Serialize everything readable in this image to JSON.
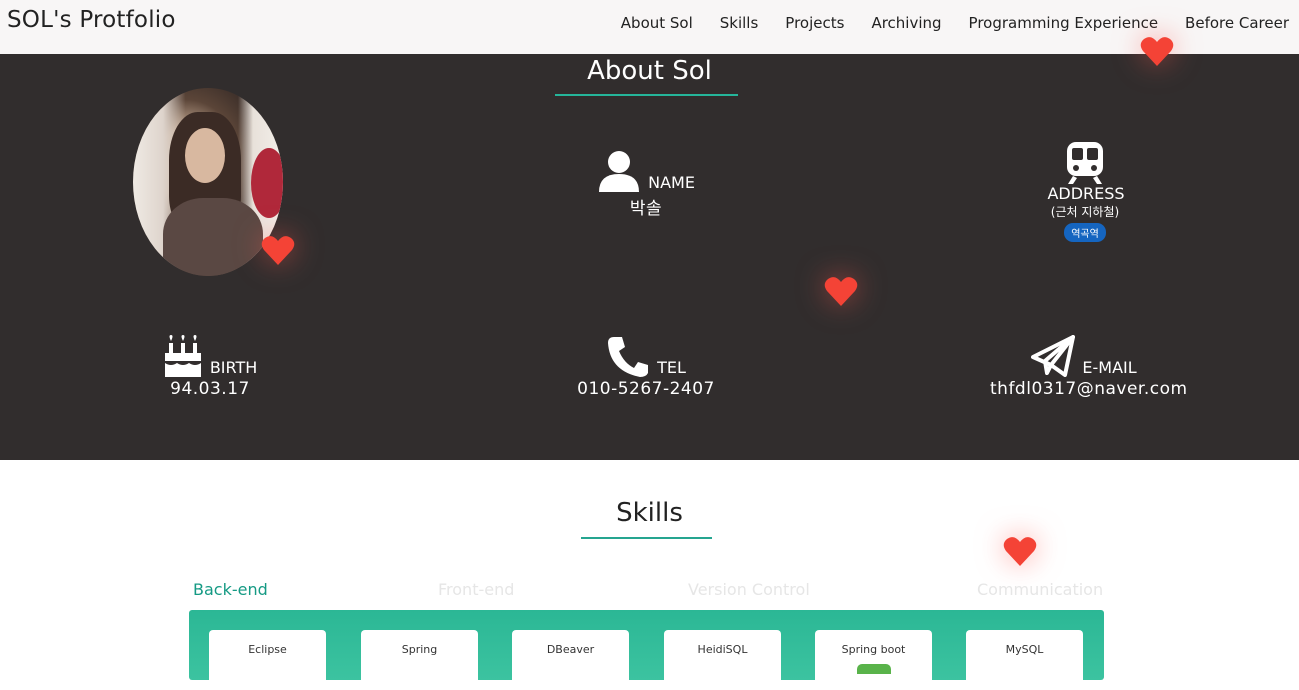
{
  "header": {
    "brand": "SOL's Protfolio",
    "nav": [
      "About Sol",
      "Skills",
      "Projects",
      "Archiving",
      "Programming Experience",
      "Before Career"
    ]
  },
  "about": {
    "title": "About Sol",
    "name": {
      "icon": "user-icon",
      "label": "NAME",
      "value": "박솔"
    },
    "address": {
      "icon": "train-icon",
      "label": "ADDRESS",
      "sub": "(근처 지하철)",
      "badge": "역곡역"
    },
    "birth": {
      "icon": "cake-icon",
      "label": "BIRTH",
      "value": "94.03.17"
    },
    "tel": {
      "icon": "phone-icon",
      "label": "TEL",
      "value": "010-5267-2407"
    },
    "email": {
      "icon": "paper-plane-icon",
      "label": "E-MAIL",
      "value": "thfdl0317@naver.com"
    }
  },
  "skills": {
    "title": "Skills",
    "tabs": [
      "Back-end",
      "Front-end",
      "Version Control",
      "Communication"
    ],
    "active_tab": "Back-end",
    "cards": [
      "Eclipse",
      "Spring",
      "DBeaver",
      "HeidiSQL",
      "Spring boot",
      "MySQL"
    ]
  },
  "colors": {
    "header_bg": "#f8f6f6",
    "about_bg": "#312d2d",
    "accent": "#25b59a",
    "heart": "#f44336",
    "badge": "#1565c0"
  }
}
